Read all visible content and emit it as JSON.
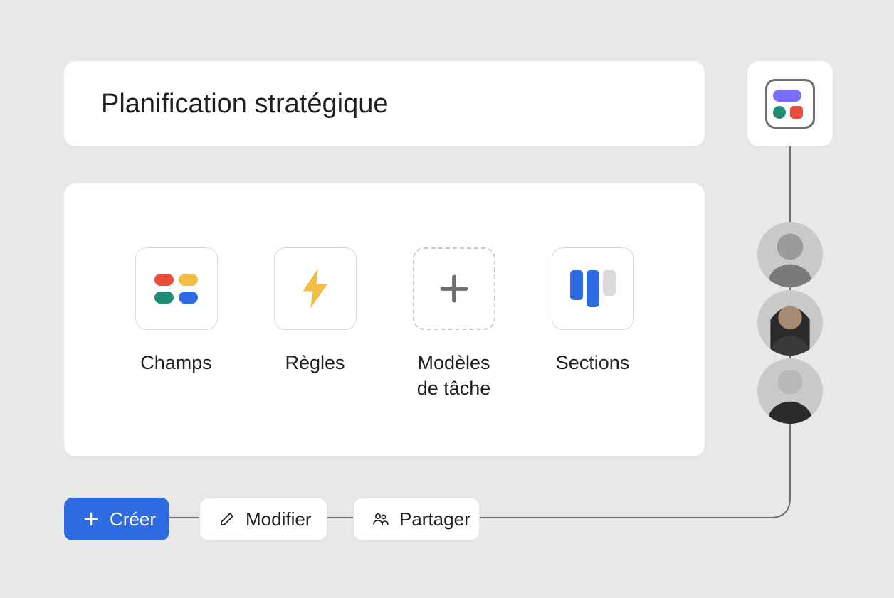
{
  "title": "Planification stratégique",
  "options": {
    "fields": {
      "label": "Champs"
    },
    "rules": {
      "label": "Règles"
    },
    "task_templates": {
      "label": "Modèles\nde tâche"
    },
    "sections": {
      "label": "Sections"
    }
  },
  "buttons": {
    "create": "Créer",
    "edit": "Modifier",
    "share": "Partager"
  },
  "colors": {
    "primary_blue": "#2e6ae1",
    "purple": "#796eff",
    "green": "#1f8d75",
    "red": "#e94e3a",
    "amber": "#f1bd45",
    "gray_bg": "#e8e8e8"
  }
}
